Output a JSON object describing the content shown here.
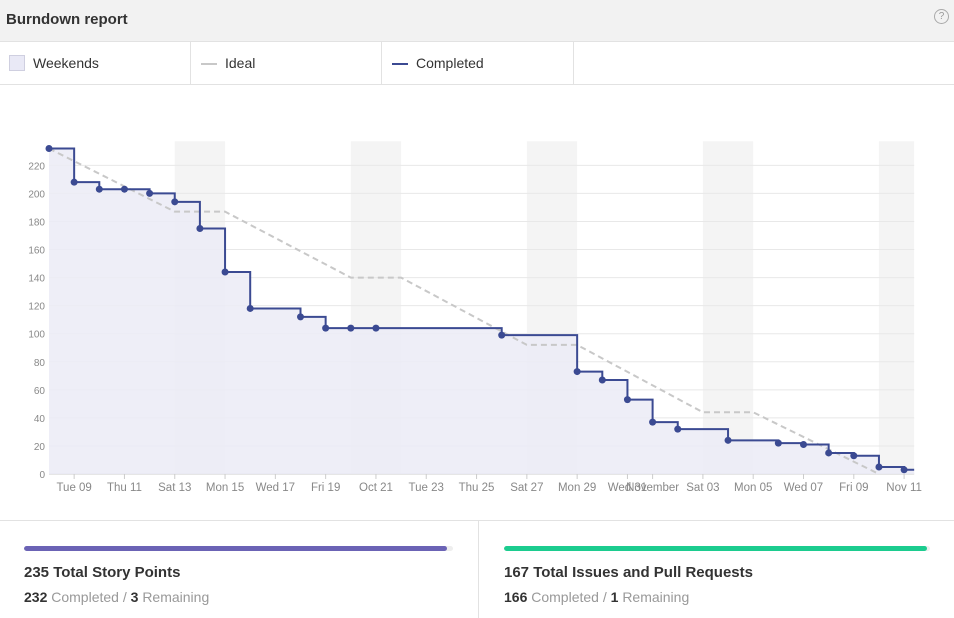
{
  "header": {
    "title": "Burndown report",
    "help_icon": "?"
  },
  "legend": {
    "weekends_label": "Weekends",
    "ideal_label": "Ideal",
    "completed_label": "Completed"
  },
  "colors": {
    "completed": "#3b4a92",
    "ideal": "#c8c8c8",
    "area": "#ebebf6",
    "weekend": "#f4f4f4",
    "story_bar": "#6b63b5",
    "issues_bar": "#1ccc8f"
  },
  "chart_data": {
    "type": "line",
    "title": "",
    "xlabel": "",
    "ylabel": "",
    "ylim": [
      0,
      240
    ],
    "yticks": [
      0,
      20,
      40,
      60,
      80,
      100,
      120,
      140,
      160,
      180,
      200,
      220
    ],
    "x_start": "Oct 08",
    "x_end": "Nov 11",
    "xticks": [
      {
        "date": "Oct 09",
        "label": "Tue 09"
      },
      {
        "date": "Oct 11",
        "label": "Thu 11"
      },
      {
        "date": "Oct 13",
        "label": "Sat 13"
      },
      {
        "date": "Oct 15",
        "label": "Mon 15"
      },
      {
        "date": "Oct 17",
        "label": "Wed 17"
      },
      {
        "date": "Oct 19",
        "label": "Fri 19"
      },
      {
        "date": "Oct 21",
        "label": "Oct 21"
      },
      {
        "date": "Oct 23",
        "label": "Tue 23"
      },
      {
        "date": "Oct 25",
        "label": "Thu 25"
      },
      {
        "date": "Oct 27",
        "label": "Sat 27"
      },
      {
        "date": "Oct 29",
        "label": "Mon 29"
      },
      {
        "date": "Oct 31",
        "label": "Wed 31"
      },
      {
        "date": "Nov 01",
        "label": "November"
      },
      {
        "date": "Nov 03",
        "label": "Sat 03"
      },
      {
        "date": "Nov 05",
        "label": "Mon 05"
      },
      {
        "date": "Nov 07",
        "label": "Wed 07"
      },
      {
        "date": "Nov 09",
        "label": "Fri 09"
      },
      {
        "date": "Nov 11",
        "label": "Nov 11"
      }
    ],
    "weekends": [
      {
        "start": "Oct 13",
        "end": "Oct 15"
      },
      {
        "start": "Oct 20",
        "end": "Oct 22"
      },
      {
        "start": "Oct 27",
        "end": "Oct 29"
      },
      {
        "start": "Nov 03",
        "end": "Nov 05"
      },
      {
        "start": "Nov 10",
        "end": "Nov 11.4"
      }
    ],
    "series": [
      {
        "name": "Ideal",
        "style": "dashed",
        "points": [
          [
            "Oct 08",
            232
          ],
          [
            "Oct 13",
            187
          ],
          [
            "Oct 15",
            187
          ],
          [
            "Oct 20",
            140
          ],
          [
            "Oct 22",
            140
          ],
          [
            "Oct 27",
            92
          ],
          [
            "Oct 29",
            92
          ],
          [
            "Nov 03",
            44
          ],
          [
            "Nov 05",
            44
          ],
          [
            "Nov 10",
            0
          ]
        ]
      },
      {
        "name": "Completed",
        "style": "step",
        "points": [
          [
            "Oct 08",
            232
          ],
          [
            "Oct 09",
            208
          ],
          [
            "Oct 10",
            203
          ],
          [
            "Oct 11",
            203
          ],
          [
            "Oct 12",
            200
          ],
          [
            "Oct 13",
            194
          ],
          [
            "Oct 14",
            175
          ],
          [
            "Oct 15",
            144
          ],
          [
            "Oct 16",
            118
          ],
          [
            "Oct 18",
            112
          ],
          [
            "Oct 19",
            104
          ],
          [
            "Oct 20",
            104
          ],
          [
            "Oct 21",
            104
          ],
          [
            "Oct 26",
            99
          ],
          [
            "Oct 29",
            73
          ],
          [
            "Oct 30",
            67
          ],
          [
            "Oct 31",
            53
          ],
          [
            "Nov 01",
            37
          ],
          [
            "Nov 02",
            32
          ],
          [
            "Nov 04",
            24
          ],
          [
            "Nov 06",
            22
          ],
          [
            "Nov 07",
            21
          ],
          [
            "Nov 08",
            15
          ],
          [
            "Nov 09",
            13
          ],
          [
            "Nov 10",
            5
          ],
          [
            "Nov 11",
            3
          ]
        ],
        "end": [
          "Nov 11.4",
          3
        ]
      }
    ]
  },
  "stats": {
    "story_points": {
      "title": "235 Total Story Points",
      "completed_value": "232",
      "completed_label": "Completed",
      "separator": "/",
      "remaining_value": "3",
      "remaining_label": "Remaining",
      "progress": 0.987
    },
    "issues": {
      "title": "167 Total Issues and Pull Requests",
      "completed_value": "166",
      "completed_label": "Completed",
      "separator": "/",
      "remaining_value": "1",
      "remaining_label": "Remaining",
      "progress": 0.994
    }
  }
}
